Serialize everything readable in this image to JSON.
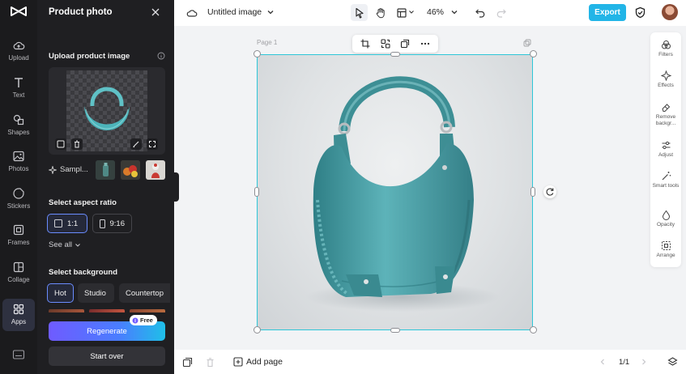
{
  "rail": {
    "items": [
      {
        "label": "Upload",
        "icon": "cloud-upload-icon"
      },
      {
        "label": "Text",
        "icon": "text-icon"
      },
      {
        "label": "Shapes",
        "icon": "shapes-icon"
      },
      {
        "label": "Photos",
        "icon": "photo-icon"
      },
      {
        "label": "Stickers",
        "icon": "sticker-icon"
      },
      {
        "label": "Frames",
        "icon": "frame-icon"
      },
      {
        "label": "Collage",
        "icon": "collage-icon"
      },
      {
        "label": "Apps",
        "icon": "grid-icon"
      }
    ],
    "active": "Apps"
  },
  "panel": {
    "title": "Product photo",
    "upload_title": "Upload product image",
    "sample_label": "Sampl...",
    "aspect_title": "Select aspect ratio",
    "ratios": [
      "1:1",
      "9:16"
    ],
    "see_all": "See all",
    "background_title": "Select background",
    "backgrounds": [
      "Hot",
      "Studio",
      "Countertop"
    ],
    "regenerate": "Regenerate",
    "free_badge": "Free",
    "start_over": "Start over"
  },
  "topbar": {
    "doc_title": "Untitled image",
    "zoom": "46%",
    "export": "Export"
  },
  "canvas": {
    "page_label": "Page 1"
  },
  "right_tools": [
    "Filters",
    "Effects",
    "Remove backgr...",
    "Adjust",
    "Smart tools",
    "Opacity",
    "Arrange"
  ],
  "bottombar": {
    "add_page": "Add page",
    "pager": "1/1"
  },
  "colors": {
    "accent": "#22b5e7",
    "selection": "#2ec6d8",
    "bag": "#4fa6ad"
  }
}
